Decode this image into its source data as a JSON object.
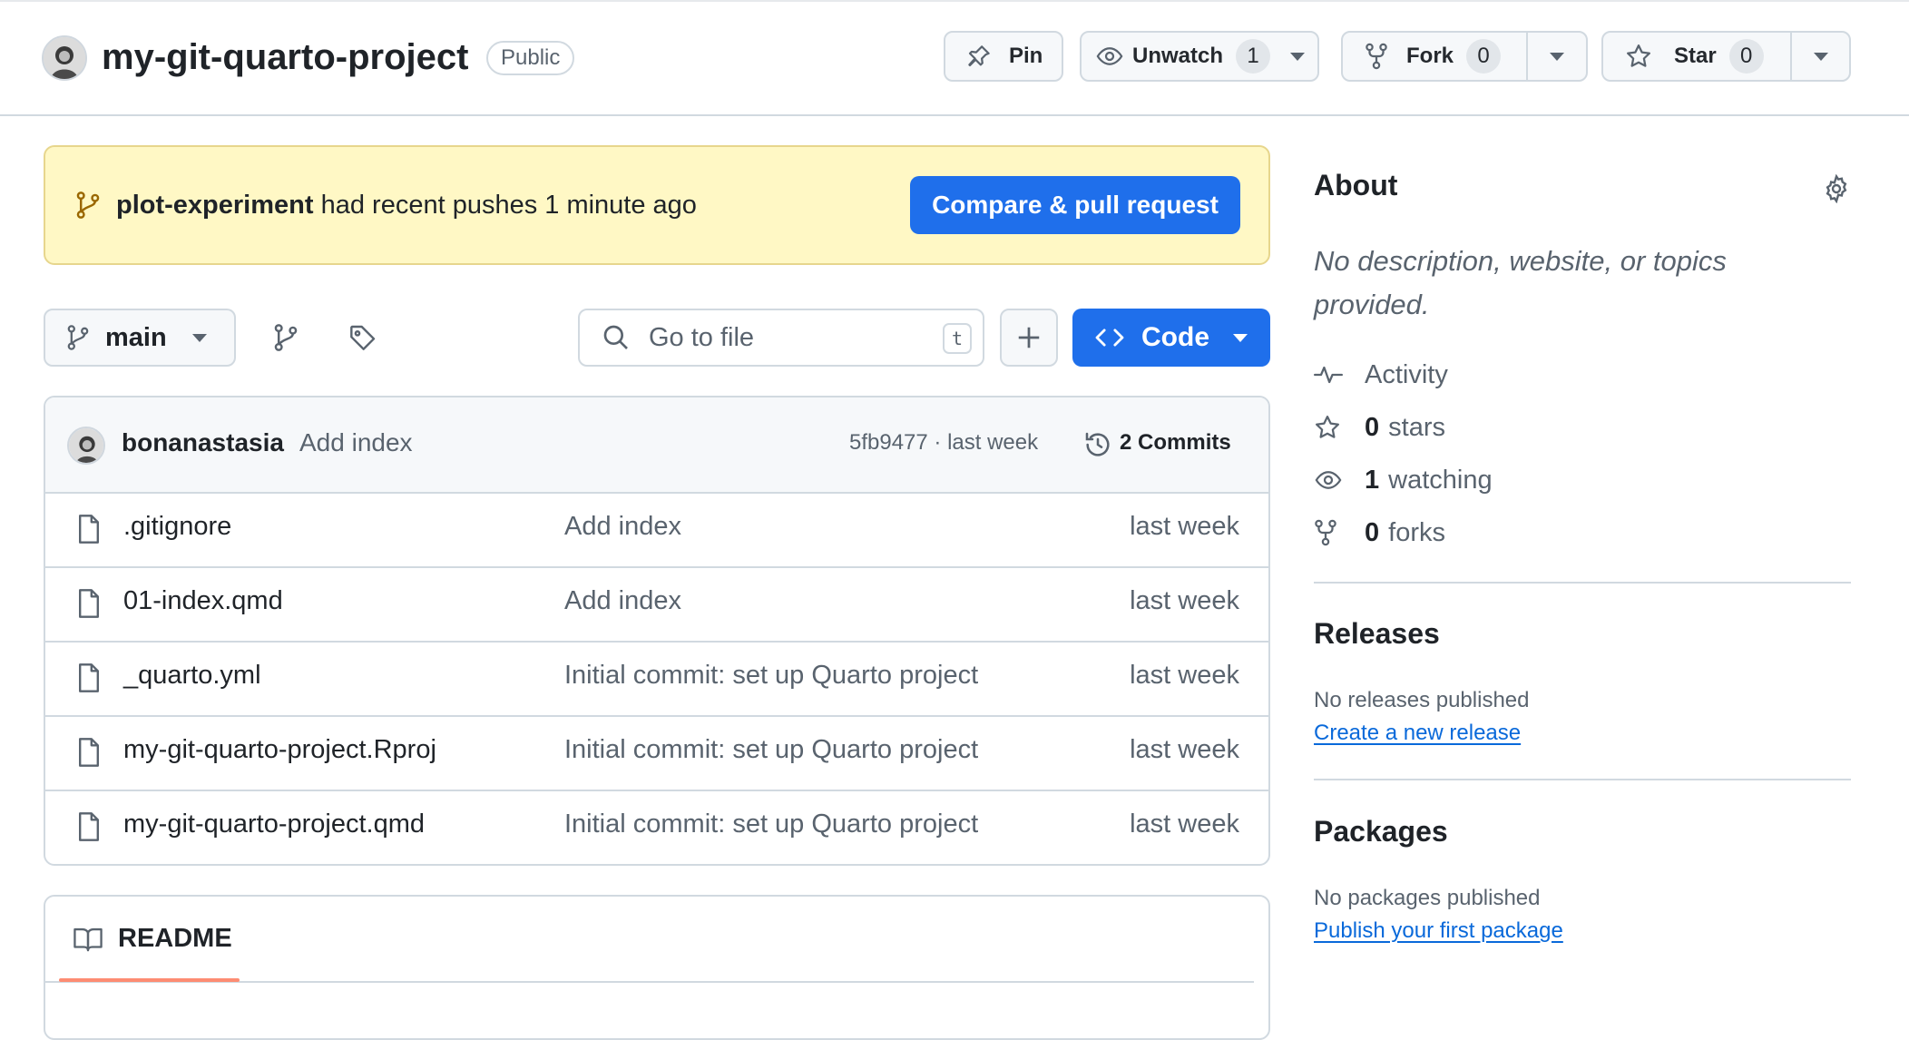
{
  "header": {
    "repo_name": "my-git-quarto-project",
    "visibility": "Public",
    "pin_label": "Pin",
    "unwatch_label": "Unwatch",
    "watch_count": "1",
    "fork_label": "Fork",
    "fork_count": "0",
    "star_label": "Star",
    "star_count": "0"
  },
  "banner": {
    "branch": "plot-experiment",
    "message": " had recent pushes 1 minute ago",
    "button_label": "Compare & pull request"
  },
  "toolbar": {
    "branch": "main",
    "search_placeholder": "Go to file",
    "shortcut": "t",
    "code_label": "Code"
  },
  "latest_commit": {
    "author": "bonanastasia",
    "message": "Add index",
    "sha_time": "5fb9477 · last week",
    "commits_label": "2 Commits"
  },
  "files": [
    {
      "name": ".gitignore",
      "message": "Add index",
      "time": "last week"
    },
    {
      "name": "01-index.qmd",
      "message": "Add index",
      "time": "last week"
    },
    {
      "name": "_quarto.yml",
      "message": "Initial commit: set up Quarto project",
      "time": "last week"
    },
    {
      "name": "my-git-quarto-project.Rproj",
      "message": "Initial commit: set up Quarto project",
      "time": "last week"
    },
    {
      "name": "my-git-quarto-project.qmd",
      "message": "Initial commit: set up Quarto project",
      "time": "last week"
    }
  ],
  "readme": {
    "label": "README"
  },
  "about": {
    "title": "About",
    "description": "No description, website, or topics provided.",
    "activity_label": "Activity",
    "stars_count": "0",
    "stars_label": "stars",
    "watching_count": "1",
    "watching_label": "watching",
    "forks_count": "0",
    "forks_label": "forks"
  },
  "releases": {
    "title": "Releases",
    "empty_text": "No releases published",
    "link": "Create a new release"
  },
  "packages": {
    "title": "Packages",
    "empty_text": "No packages published",
    "link": "Publish your first package"
  },
  "colors": {
    "accent": "#1f6feb",
    "link": "#0969da",
    "banner_bg": "#fff8c5",
    "tab_underline": "#fd8c73"
  }
}
